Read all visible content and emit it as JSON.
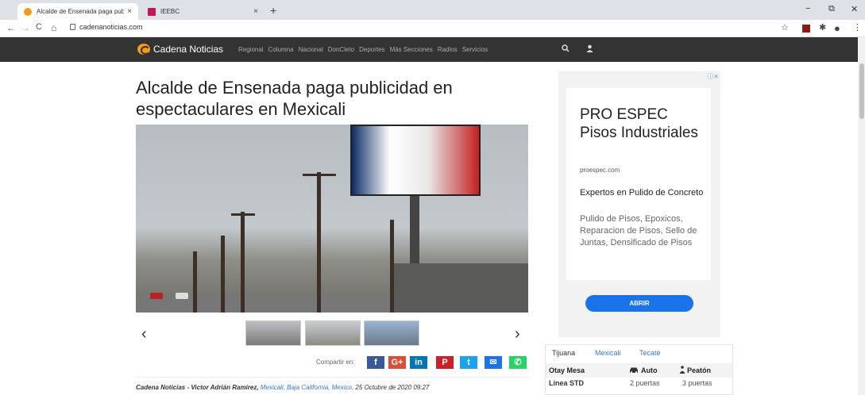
{
  "browser": {
    "tabs": [
      {
        "title": "Alcalde de Ensenada paga public",
        "close": "×",
        "favicon_color": "#f29a1a"
      },
      {
        "title": "IEEBC",
        "close": "×",
        "favicon_color": "#c2185b"
      }
    ],
    "new_tab": "+",
    "url": "cadenanoticias.com",
    "window_controls": {
      "minimize": "−",
      "maximize": "⧉",
      "close": "✕"
    },
    "nav": {
      "back": "←",
      "forward": "→",
      "reload": "C",
      "home": "⌂"
    },
    "extensions": {
      "star": "☆",
      "pin": "✱",
      "profile": "●",
      "more": "⋮"
    }
  },
  "site": {
    "logo": "Cadena Noticias",
    "menu": [
      "Regional",
      "Columna",
      "Nacional",
      "DonCleto",
      "Deportes",
      "Más Secciones",
      "Radios",
      "Servicios"
    ],
    "search_icon": "search-icon",
    "user_icon": "user-icon"
  },
  "article": {
    "headline": "Alcalde de Ensenada paga publicidad en espectaculares en Mexicali",
    "carousel_prev": "‹",
    "carousel_next": "›",
    "share_label": "Compartir en:",
    "share_buttons": [
      {
        "label": "f",
        "color": "#3b5998"
      },
      {
        "label": "G+",
        "color": "#dd4b39"
      },
      {
        "label": "in",
        "color": "#0077b5"
      },
      {
        "label": "P",
        "color": "#cb2027"
      },
      {
        "label": "t",
        "color": "#1da1f2"
      },
      {
        "label": "✉",
        "color": "#1a73e8"
      },
      {
        "label": "✆",
        "color": "#25d366"
      }
    ],
    "author": "Cadena Noticias - Victor Adrián Ramírez,",
    "place": "Mexicali, Baja California, Mexico,",
    "date": "25 Octubre de 2020 09:27"
  },
  "ad": {
    "choices": "ⓘ✕",
    "title": "PRO ESPEC Pisos Industriales",
    "domain": "proespec.com",
    "subtitle": "Expertos en Pulido de Concreto",
    "body": "Pulido de Pisos, Epoxicos, Reparacion de Pisos, Sello de Juntas, Densificado de Pisos",
    "cta": "ABRIR"
  },
  "border_widget": {
    "tabs": [
      "Tijuana",
      "Mexicali",
      "Tecate"
    ],
    "active_tab": "Tijuana",
    "columns": [
      "Otay Mesa",
      "Auto",
      "Peatón"
    ],
    "rows": [
      {
        "name": "Linea STD",
        "auto": "2 puertas",
        "peaton": "3 puertas"
      }
    ]
  }
}
